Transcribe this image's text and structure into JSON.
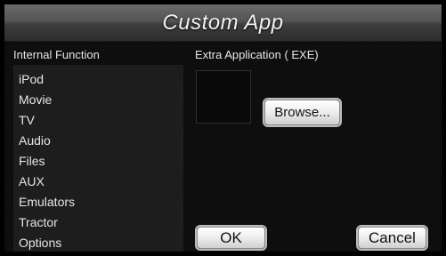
{
  "window": {
    "title": "Custom App"
  },
  "internal": {
    "header": "Internal Function",
    "items": [
      "iPod",
      "Movie",
      "TV",
      "Audio",
      "Files",
      "AUX",
      "Emulators",
      "Tractor",
      "Options"
    ]
  },
  "extra": {
    "header": "Extra Application ( EXE)",
    "browse_label": "Browse..."
  },
  "actions": {
    "ok_label": "OK",
    "cancel_label": "Cancel"
  },
  "colors": {
    "background": "#0c0c0c",
    "button_face": "#efefef",
    "text": "#e6e6e6"
  }
}
